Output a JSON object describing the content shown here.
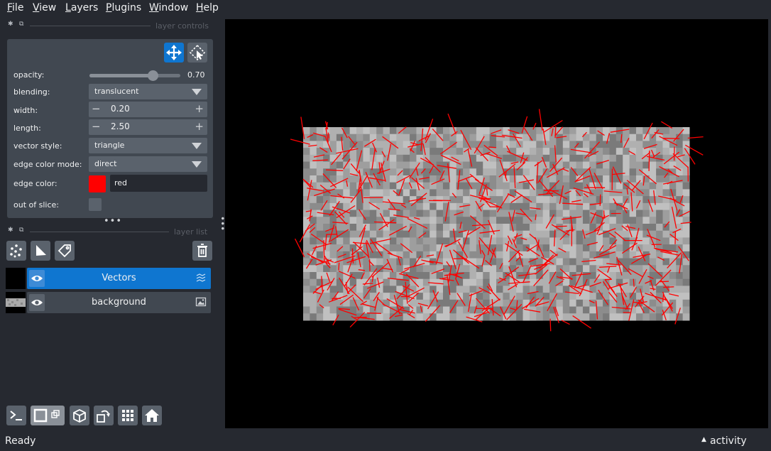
{
  "menu": {
    "file": {
      "first": "F",
      "rest": "ile"
    },
    "view": {
      "first": "V",
      "rest": "iew"
    },
    "layers": {
      "first": "L",
      "rest": "ayers"
    },
    "plugins": {
      "first": "P",
      "rest": "lugins"
    },
    "window": {
      "first": "W",
      "rest": "indow"
    },
    "help": {
      "first": "H",
      "rest": "elp"
    }
  },
  "layer_controls": {
    "title": "layer controls",
    "opacity": {
      "label": "opacity:",
      "value": 0.7,
      "value_text": "0.70"
    },
    "blending": {
      "label": "blending:",
      "value": "translucent"
    },
    "width": {
      "label": "width:",
      "value": "0.20"
    },
    "length": {
      "label": "length:",
      "value": "2.50"
    },
    "vector_style": {
      "label": "vector style:",
      "value": "triangle"
    },
    "edge_color_mode": {
      "label": "edge color mode:",
      "value": "direct"
    },
    "edge_color": {
      "label": "edge color:",
      "value": "red",
      "swatch": "#ff0000"
    },
    "out_of_slice": {
      "label": "out of slice:",
      "checked": false
    }
  },
  "layer_list": {
    "title": "layer list",
    "layers": [
      {
        "name": "Vectors",
        "selected": true,
        "type_icon": "vectors-icon"
      },
      {
        "name": "background",
        "selected": false,
        "type_icon": "image-icon"
      }
    ]
  },
  "colors": {
    "accent": "#0f76d0",
    "panel": "#414851",
    "widget": "#5a626c",
    "background": "#262930",
    "vector": "#ff0000"
  },
  "canvas": {
    "image": {
      "cols": 58,
      "rows": 28,
      "grays": [
        "#7a7a7a",
        "#8c8c8c",
        "#9e9e9e",
        "#b0b0b0",
        "#c0c0c0"
      ]
    },
    "vectors": {
      "count": 620,
      "color": "#ff0000"
    }
  },
  "status": {
    "text": "Ready",
    "activity": "activity"
  }
}
